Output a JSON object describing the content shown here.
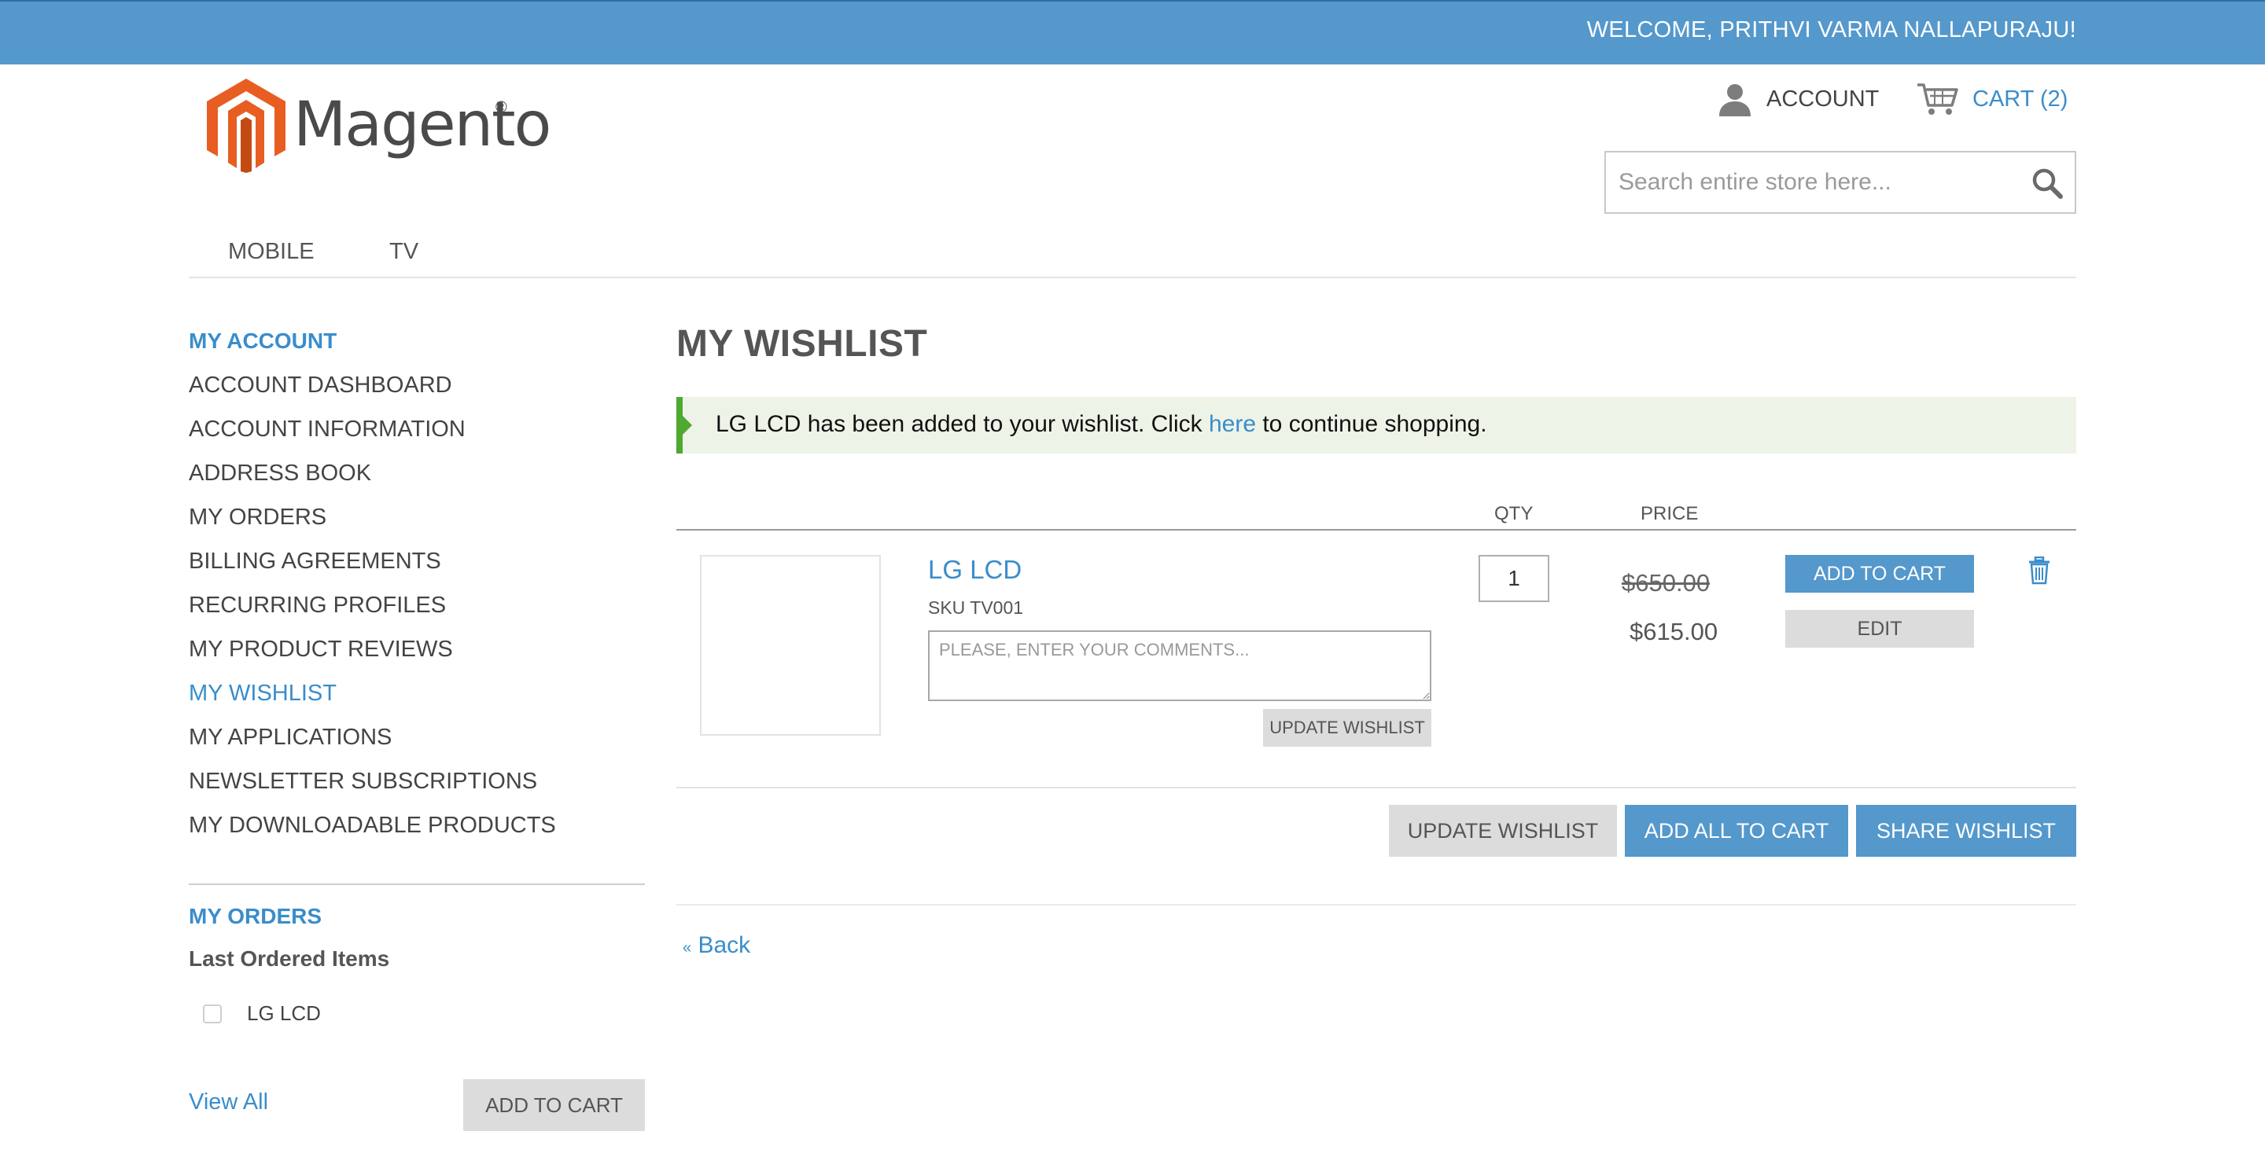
{
  "topbar": {
    "welcome": "WELCOME, PRITHVI VARMA NALLAPURAJU!"
  },
  "header": {
    "logo_text": "Magento",
    "account_label": "ACCOUNT",
    "cart_label": "CART (2)",
    "search_placeholder": "Search entire store here..."
  },
  "nav": {
    "items": [
      "MOBILE",
      "TV"
    ]
  },
  "sidebar": {
    "title": "MY ACCOUNT",
    "items": [
      "ACCOUNT DASHBOARD",
      "ACCOUNT INFORMATION",
      "ADDRESS BOOK",
      "MY ORDERS",
      "BILLING AGREEMENTS",
      "RECURRING PROFILES",
      "MY PRODUCT REVIEWS",
      "MY WISHLIST",
      "MY APPLICATIONS",
      "NEWSLETTER SUBSCRIPTIONS",
      "MY DOWNLOADABLE PRODUCTS"
    ],
    "active_item": "MY WISHLIST",
    "orders_title": "MY ORDERS",
    "last_ordered_title": "Last Ordered Items",
    "last_ordered_item": "LG LCD",
    "view_all": "View All",
    "add_to_cart": "ADD TO CART"
  },
  "main": {
    "title": "MY WISHLIST",
    "message": {
      "before": "LG LCD has been added to your wishlist. Click ",
      "link": "here",
      "after": " to continue shopping."
    },
    "columns": {
      "qty": "QTY",
      "price": "PRICE"
    },
    "item": {
      "name": "LG LCD",
      "sku": "SKU TV001",
      "comment_placeholder": "PLEASE, ENTER YOUR COMMENTS...",
      "update_button": "UPDATE WISHLIST",
      "qty": "1",
      "old_price": "$650.00",
      "price": "$615.00",
      "add_to_cart": "ADD TO CART",
      "edit": "EDIT"
    },
    "actions": {
      "update_wishlist": "UPDATE WISHLIST",
      "add_all_to_cart": "ADD ALL TO CART",
      "share_wishlist": "SHARE WISHLIST"
    },
    "back": {
      "arrow": "«",
      "label": "Back"
    }
  },
  "colors": {
    "brand_blue": "#5498cc",
    "link_blue": "#3a8dcb",
    "success_green": "#4fa82f",
    "logo_orange": "#e85d22"
  }
}
